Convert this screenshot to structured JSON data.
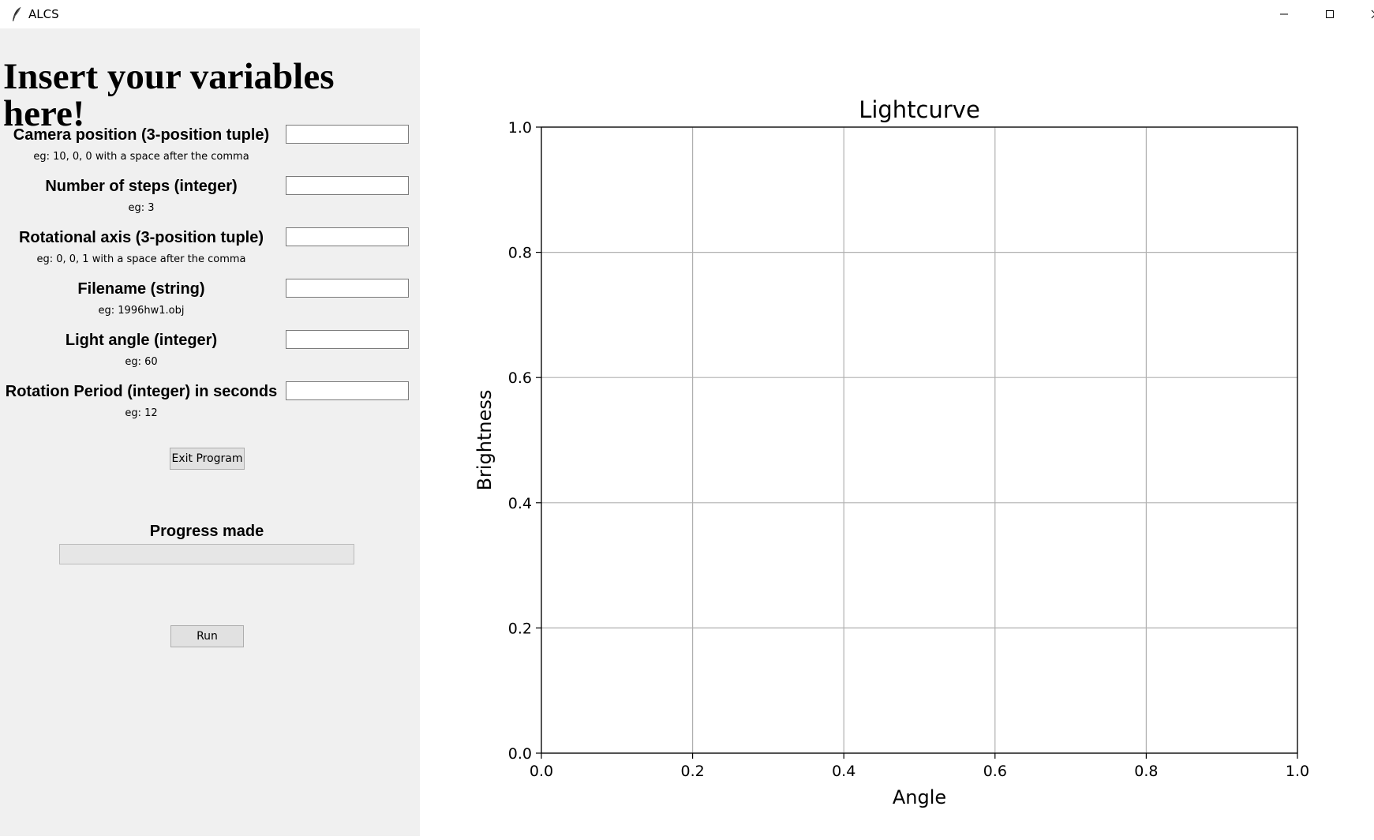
{
  "window": {
    "title": "ALCS",
    "app_icon": "feather-icon",
    "controls": [
      "minimize-icon",
      "maximize-icon",
      "close-icon"
    ]
  },
  "form": {
    "heading": "Insert your variables here!",
    "fields": [
      {
        "label": "Camera position (3-position tuple)",
        "hint": "eg: 10, 0, 0 with a space after the comma",
        "value": ""
      },
      {
        "label": "Number of steps (integer)",
        "hint": "eg: 3",
        "value": ""
      },
      {
        "label": "Rotational axis (3-position tuple)",
        "hint": "eg: 0, 0, 1 with a space after the comma",
        "value": ""
      },
      {
        "label": "Filename (string)",
        "hint": "eg: 1996hw1.obj",
        "value": ""
      },
      {
        "label": "Light angle (integer)",
        "hint": "eg: 60",
        "value": ""
      },
      {
        "label": "Rotation Period (integer) in seconds",
        "hint": "eg: 12",
        "value": ""
      }
    ],
    "exit_button": "Exit Program",
    "progress_label": "Progress made",
    "progress_fraction": 0,
    "run_button": "Run"
  },
  "chart_data": {
    "type": "line",
    "title": "Lightcurve",
    "xlabel": "Angle",
    "ylabel": "Brightness",
    "xlim": [
      0.0,
      1.0
    ],
    "ylim": [
      0.0,
      1.0
    ],
    "xticks": [
      "0.0",
      "0.2",
      "0.4",
      "0.6",
      "0.8",
      "1.0"
    ],
    "yticks": [
      "0.0",
      "0.2",
      "0.4",
      "0.6",
      "0.8",
      "1.0"
    ],
    "grid": true,
    "series": []
  }
}
